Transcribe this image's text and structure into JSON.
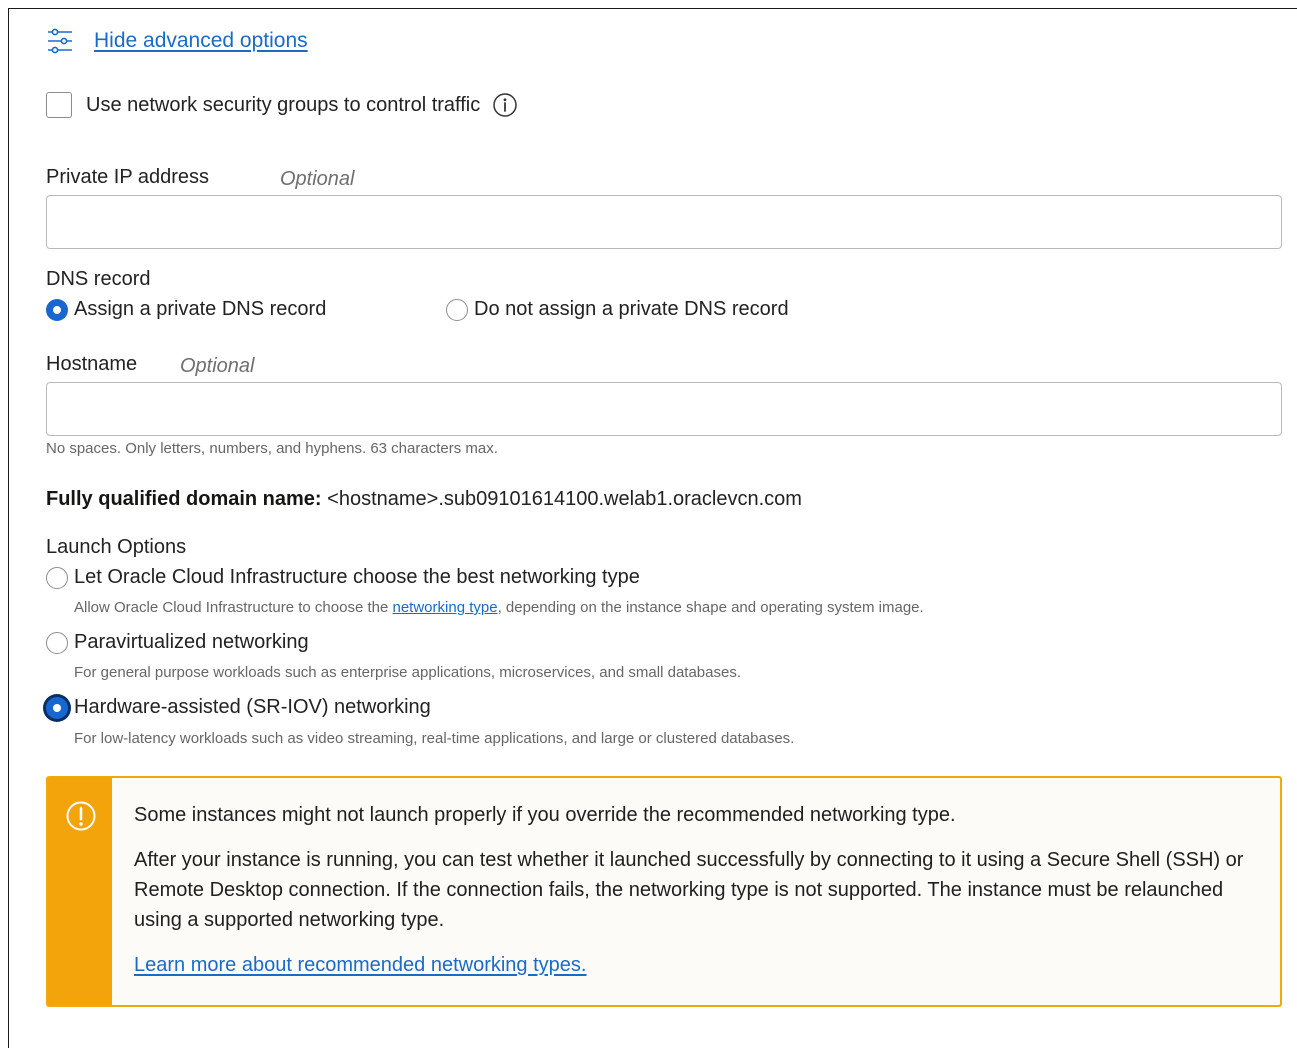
{
  "advanced": {
    "toggle_label": "Hide advanced options"
  },
  "nsg": {
    "label": "Use network security groups to control traffic",
    "checked": false
  },
  "private_ip": {
    "label": "Private IP address",
    "optional": "Optional",
    "value": ""
  },
  "dns_record": {
    "label": "DNS record",
    "options": [
      {
        "label": "Assign a private DNS record",
        "selected": true
      },
      {
        "label": "Do not assign a private DNS record",
        "selected": false
      }
    ]
  },
  "hostname": {
    "label": "Hostname",
    "optional": "Optional",
    "value": "",
    "help": "No spaces. Only letters, numbers, and hyphens. 63 characters max."
  },
  "fqdn": {
    "label": "Fully qualified domain name:",
    "value": "<hostname>.sub09101614100.welab1.oraclevcn.com"
  },
  "launch_options": {
    "label": "Launch Options",
    "options": [
      {
        "label": "Let Oracle Cloud Infrastructure choose the best networking type",
        "help_before": "Allow Oracle Cloud Infrastructure to choose the ",
        "help_link": "networking type",
        "help_after": ", depending on the instance shape and operating system image.",
        "selected": false
      },
      {
        "label": "Paravirtualized networking",
        "help": "For general purpose workloads such as enterprise applications, microservices, and small databases.",
        "selected": false
      },
      {
        "label": "Hardware-assisted (SR-IOV) networking",
        "help": "For low-latency workloads such as video streaming, real-time applications, and large or clustered databases.",
        "selected": true
      }
    ]
  },
  "warning": {
    "title": "Some instances might not launch properly if you override the recommended networking type.",
    "body": "After your instance is running, you can test whether it launched successfully by connecting to it using a Secure Shell (SSH) or Remote Desktop connection. If the connection fails, the networking type is not supported. The instance must be relaunched using a supported networking type.",
    "link": "Learn more about recommended networking types."
  },
  "colors": {
    "link": "#1a6bc7",
    "radio_selected": "#1867d0",
    "warning_accent": "#f4a40b"
  }
}
